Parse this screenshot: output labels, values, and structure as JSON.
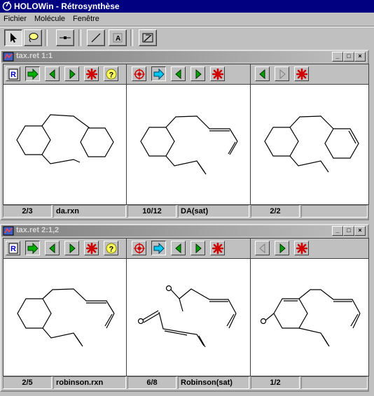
{
  "app": {
    "title": "HOLOWin - Rétrosynthèse"
  },
  "menu": [
    "Fichier",
    "Molécule",
    "Fenêtre"
  ],
  "colors": {
    "titlebar": "#000080",
    "arrow_green": "#00a000",
    "arrow_cyan": "#00c0e0",
    "cross_red": "#d00000"
  },
  "windows": [
    {
      "title": "tax.ret 1:1",
      "status": [
        "2/3",
        "da.rxn",
        "10/12",
        "DA(sat)",
        "2/2",
        ""
      ]
    },
    {
      "title": "tax.ret 2:1,2",
      "status": [
        "2/5",
        "robinson.rxn",
        "6/8",
        "Robinson(sat)",
        "1/2",
        ""
      ]
    }
  ]
}
